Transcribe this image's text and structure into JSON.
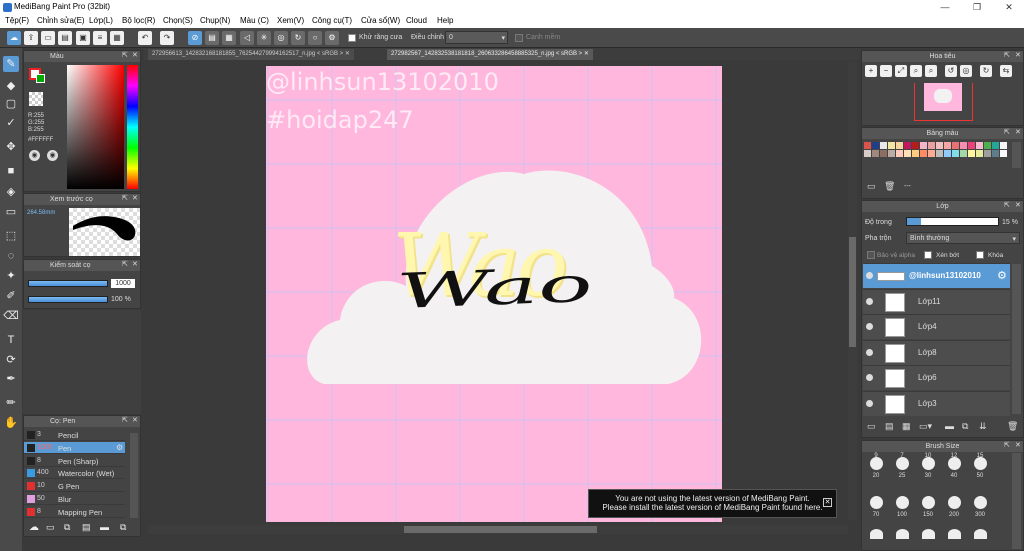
{
  "window": {
    "title": "MediBang Paint Pro (32bit)",
    "minimize": "—",
    "restore": "❐",
    "close": "✕"
  },
  "menu": [
    "Tệp(F)",
    "Chỉnh sửa(E)",
    "Lớp(L)",
    "Bộ lọc(R)",
    "Chọn(S)",
    "Chụp(N)",
    "Màu (C)",
    "Xem(V)",
    "Công cụ(T)",
    "Cửa sổ(W)",
    "Cloud",
    "Help"
  ],
  "toolbar": {
    "antialias_label": "Khử răng cưa",
    "correction_label": "Điều chỉnh",
    "correction_value": "0",
    "soft_edge_label": "Cạnh mềm"
  },
  "tabs": [
    {
      "label": "272956613_142832168181855_762544279994162517_n.jpg < sRGB >"
    },
    {
      "label": "272982567_142832538181818_260633286458885325_n.jpg < sRGB >"
    }
  ],
  "color_panel": {
    "title": "Màu",
    "r": "R:255",
    "g": "G:255",
    "b": "B:255",
    "hex": "#FFFFFF"
  },
  "brush_preview": {
    "title": "Xem trước cọ",
    "size": "264.58mm"
  },
  "brush_control": {
    "title": "Kiểm soát cọ",
    "size_value": "1000",
    "opacity_value": "100 %"
  },
  "brush_list": {
    "title": "Cọ: Pen",
    "items": [
      {
        "size": "3",
        "name": "Pencil",
        "color": "#222222"
      },
      {
        "size": "1000",
        "name": "Pen",
        "color": "#222222",
        "selected": true
      },
      {
        "size": "8",
        "name": "Pen (Sharp)",
        "color": "#222222"
      },
      {
        "size": "400",
        "name": "Watercolor (Wet)",
        "color": "#3a9be0"
      },
      {
        "size": "10",
        "name": "G Pen",
        "color": "#e03030"
      },
      {
        "size": "50",
        "name": "Blur",
        "color": "#e0a0e0"
      },
      {
        "size": "8",
        "name": "Mapping Pen",
        "color": "#e03030"
      }
    ]
  },
  "canvas": {
    "watermark_1": "@linhsun13102010",
    "watermark_2": "#hoidap247",
    "art_text": "Wao"
  },
  "notice": {
    "line1": "You are not using the latest version of MediBang Paint.",
    "line2": "Please install the latest version of MediBang Paint found here.",
    "close": "✕"
  },
  "navigator": {
    "title": "Hoa tiêu"
  },
  "palette": {
    "title": "Bảng màu",
    "colors": [
      "#d9534f",
      "#1f3f8a",
      "#e8e8e8",
      "#f4e6a0",
      "#f6d5a0",
      "#c2185b",
      "#b71c1c",
      "#f2b6c8",
      "#e8a0a0",
      "#f0c0c0",
      "#f5a5a5",
      "#e57373",
      "#f48fb1",
      "#ec407a",
      "#f8bbd0",
      "#4caf50",
      "#26a69a",
      "#f5f5f5",
      "#d7ccc8",
      "#a1887f",
      "#8d6e63",
      "#bcaaa4",
      "#ffccbc",
      "#ffe0b2",
      "#ffcc80",
      "#ff8a65",
      "#ffab91",
      "#bdbdbd",
      "#90caf9",
      "#80deea",
      "#a5d6a7",
      "#fff59d",
      "#e6ee9c",
      "#9e9e9e",
      "#607d8b",
      "#fafafa"
    ],
    "footer": "---"
  },
  "layer_panel": {
    "title": "Lớp",
    "opacity_label": "Độ trong",
    "opacity_value": "15 %",
    "opacity_fraction": 0.15,
    "blend_label": "Pha trộn",
    "blend_value": "Bình thường",
    "protect_alpha": "Bảo vệ alpha",
    "clipping": "Xén bớt",
    "lock": "Khóa",
    "layers": [
      {
        "name": "@linhsun13102010",
        "selected": true
      },
      {
        "name": "Lớp11"
      },
      {
        "name": "Lớp4"
      },
      {
        "name": "Lớp8"
      },
      {
        "name": "Lớp6"
      },
      {
        "name": "Lớp3"
      }
    ]
  },
  "brush_size": {
    "title": "Brush Size",
    "row0": [
      "9",
      "7",
      "10",
      "12",
      "15"
    ],
    "row1": [
      "20",
      "25",
      "30",
      "40",
      "50"
    ],
    "row2": [
      "70",
      "100",
      "150",
      "200",
      "300"
    ]
  }
}
